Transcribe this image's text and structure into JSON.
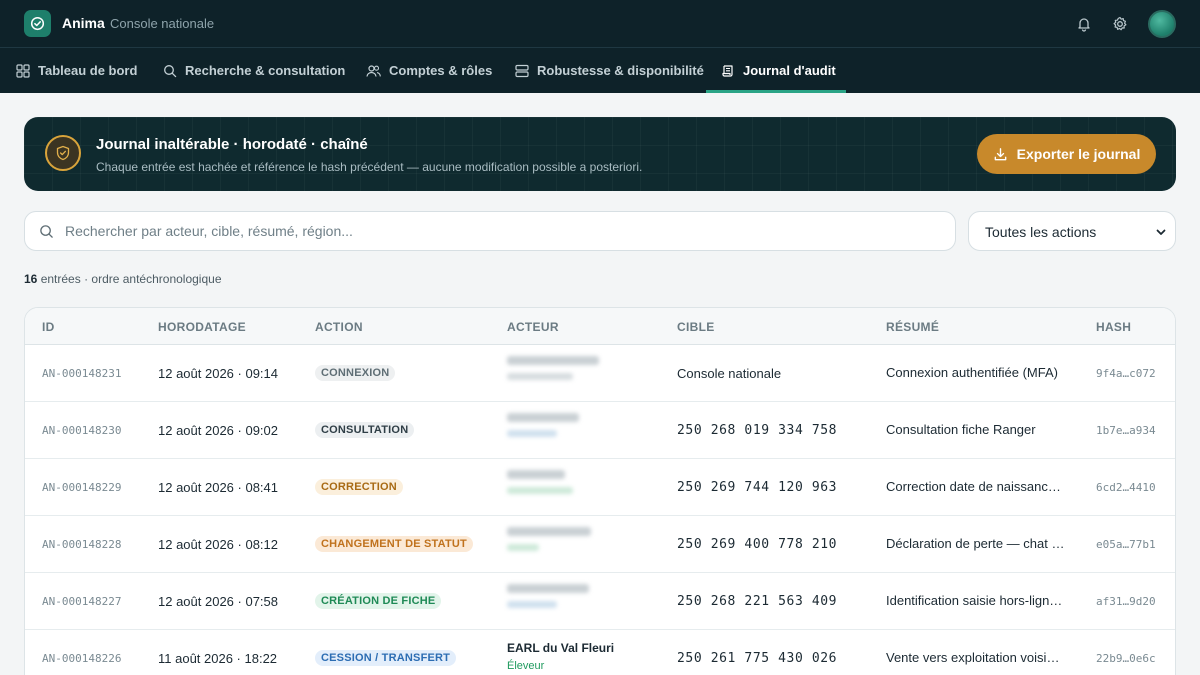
{
  "app": {
    "name": "Anima",
    "subtitle": "Console nationale"
  },
  "nav": [
    {
      "label": "Tableau de bord",
      "icon": "dashboard-icon"
    },
    {
      "label": "Recherche & consultation",
      "icon": "search-icon"
    },
    {
      "label": "Comptes & rôles",
      "icon": "users-icon"
    },
    {
      "label": "Robustesse & disponibilité",
      "icon": "server-icon"
    },
    {
      "label": "Journal d'audit",
      "icon": "scroll-icon",
      "active": true
    }
  ],
  "banner": {
    "title": "Journal inaltérable · horodaté · chaîné",
    "description": "Chaque entrée est hachée et référence le hash précédent — aucune modification possible a posteriori.",
    "export_label": "Exporter le journal"
  },
  "search": {
    "placeholder": "Rechercher par acteur, cible, résumé, région..."
  },
  "filter": {
    "selected": "Toutes les actions"
  },
  "count": {
    "number": "16",
    "text": "entrées · ordre antéchronologique"
  },
  "columns": [
    "ID",
    "HORODATAGE",
    "ACTION",
    "ACTEUR",
    "CIBLE",
    "RÉSUMÉ",
    "HASH"
  ],
  "rows": [
    {
      "id": "AN-000148231",
      "time": "12 août 2026 · 09:14",
      "action": "CONNEXION",
      "target": "Console nationale",
      "target_is_number": false,
      "summary": "Connexion authentifiée (MFA)",
      "hash": "9f4a…c072"
    },
    {
      "id": "AN-000148230",
      "time": "12 août 2026 · 09:02",
      "action": "CONSULTATION",
      "target": "250 268 019 334 758",
      "target_is_number": true,
      "summary": "Consultation fiche Ranger",
      "hash": "1b7e…a934"
    },
    {
      "id": "AN-000148229",
      "time": "12 août 2026 · 08:41",
      "action": "CORRECTION",
      "target": "250 269 744 120 963",
      "target_is_number": true,
      "summary": "Correction date de naissance…",
      "hash": "6cd2…4410"
    },
    {
      "id": "AN-000148228",
      "time": "12 août 2026 · 08:12",
      "action": "CHANGEMENT DE STATUT",
      "target": "250 269 400 778 210",
      "target_is_number": true,
      "summary": "Déclaration de perte — chat …",
      "hash": "e05a…77b1"
    },
    {
      "id": "AN-000148227",
      "time": "12 août 2026 · 07:58",
      "action": "CRÉATION DE FICHE",
      "target": "250 268 221 563 409",
      "target_is_number": true,
      "summary": "Identification saisie hors-lign…",
      "hash": "af31…9d20"
    },
    {
      "id": "AN-000148226",
      "time": "11 août 2026 · 18:22",
      "action": "CESSION / TRANSFERT",
      "actor_name": "EARL du Val Fleuri",
      "actor_role": "Éleveur",
      "target": "250 261 775 430 026",
      "target_is_number": true,
      "summary": "Vente vers exploitation voisin…",
      "hash": "22b9…0e6c"
    }
  ],
  "colors": {
    "topbar": "#0e2229",
    "accent": "#2aa486",
    "export": "#c8892b",
    "badge_connexion_bg": "#eef0f1",
    "badge_connexion_fg": "#5f6e75",
    "badge_consultation_bg": "#eceff1",
    "badge_consultation_fg": "#2f3e46",
    "badge_correction_bg": "#fbefdc",
    "badge_correction_fg": "#a86a14",
    "badge_statut_bg": "#fbe9d6",
    "badge_statut_fg": "#c0721d",
    "badge_creation_bg": "#e2f4ea",
    "badge_creation_fg": "#1f8a56",
    "badge_cession_bg": "#e3eefb",
    "badge_cession_fg": "#2c6db3"
  }
}
